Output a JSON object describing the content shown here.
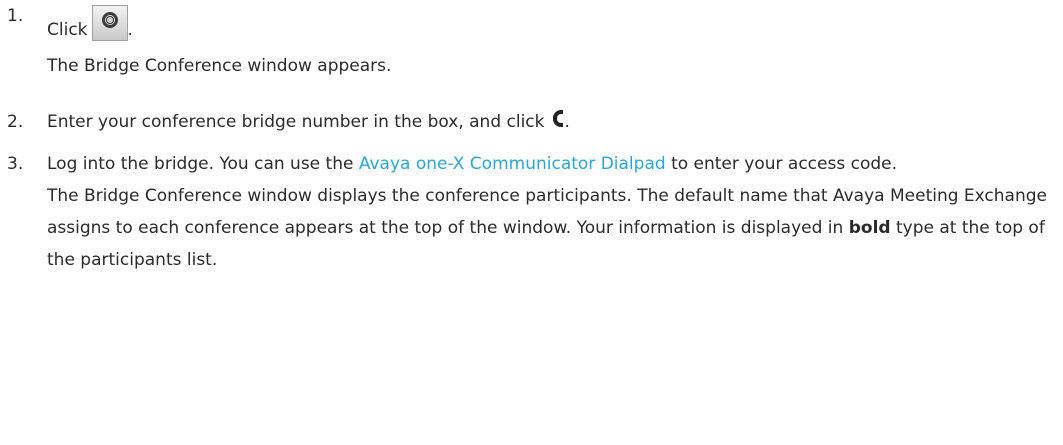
{
  "steps": [
    {
      "number": "1.",
      "pre": "Click",
      "icon": "conference-bridge-button-icon",
      "post": ".",
      "detail": "The Bridge Conference window appears."
    },
    {
      "number": "2.",
      "pre": "Enter your conference bridge number in the box, and click",
      "icon": "phone-handset-icon",
      "post": "."
    },
    {
      "number": "3.",
      "pre": "Log into the bridge. You can use the",
      "link": "Avaya one-X Communicator Dialpad",
      "post": "to enter your access code.",
      "detail_pre": "The Bridge Conference window displays the conference participants. The default name that Avaya Meeting Exchange assigns to each conference appears at the top of the window. Your information is displayed in",
      "detail_bold": "bold",
      "detail_post": "type at the top of the participants list."
    }
  ],
  "colors": {
    "text": "#2b2b2b",
    "link": "#2aa6d6"
  }
}
